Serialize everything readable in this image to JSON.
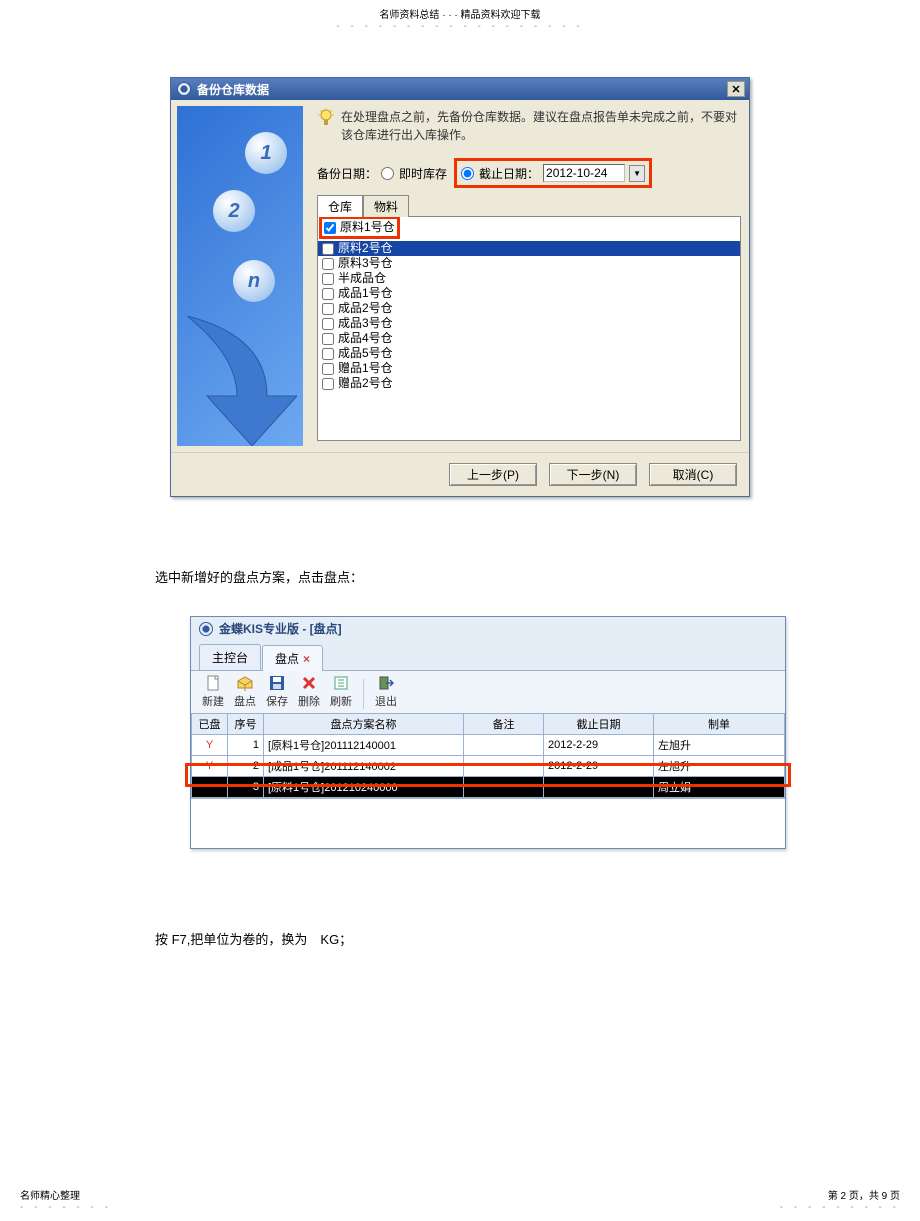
{
  "doc_header": "名师资料总结 · · · 精品资料欢迎下载",
  "dialog1": {
    "title": "备份仓库数据",
    "tip": "在处理盘点之前，先备份仓库数据。建议在盘点报告单未完成之前，不要对该仓库进行出入库操作。",
    "backup_label": "备份日期：",
    "radio_immediate": "即时库存",
    "radio_cutoff": "截止日期：",
    "cutoff_date": "2012-10-24",
    "tab_warehouse": "仓库",
    "tab_material": "物料",
    "items": [
      {
        "label": "原料1号仓",
        "checked": true,
        "red": true
      },
      {
        "label": "原料2号仓",
        "checked": false,
        "sel": true
      },
      {
        "label": "原料3号仓",
        "checked": false
      },
      {
        "label": "半成品仓",
        "checked": false
      },
      {
        "label": "成品1号仓",
        "checked": false
      },
      {
        "label": "成品2号仓",
        "checked": false
      },
      {
        "label": "成品3号仓",
        "checked": false
      },
      {
        "label": "成品4号仓",
        "checked": false
      },
      {
        "label": "成品5号仓",
        "checked": false
      },
      {
        "label": "赠品1号仓",
        "checked": false
      },
      {
        "label": "赠品2号仓",
        "checked": false
      }
    ],
    "btn_prev": "上一步(P)",
    "btn_next": "下一步(N)",
    "btn_cancel": "取消(C)"
  },
  "text1": "选中新增好的盘点方案，点击盘点：",
  "app": {
    "title": "金蝶KIS专业版 - [盘点]",
    "tab_main": "主控台",
    "tab_pd": "盘点",
    "toolbar": {
      "new": "新建",
      "pd": "盘点",
      "save": "保存",
      "del": "删除",
      "refresh": "刷新",
      "exit": "退出"
    },
    "cols": {
      "done": "已盘",
      "seq": "序号",
      "name": "盘点方案名称",
      "remark": "备注",
      "date": "截止日期",
      "maker": "制单"
    },
    "rows": [
      {
        "done": "Y",
        "seq": "1",
        "name": "[原料1号仓]201112140001",
        "remark": "",
        "date": "2012-2-29",
        "maker": "左旭升"
      },
      {
        "done": "Y",
        "seq": "2",
        "name": "[成品1号仓]201112140002",
        "remark": "",
        "date": "2012-2-29",
        "maker": "左旭升"
      },
      {
        "done": "",
        "seq": "3",
        "name": "[原料1号仓]201210240000",
        "remark": "",
        "date": "",
        "maker": "周立娟",
        "sel": true
      }
    ]
  },
  "text2": "按 F7,把单位为卷的，换为　KG；",
  "footer": {
    "left": "名师精心整理",
    "right": "第 2 页，共 9 页"
  }
}
